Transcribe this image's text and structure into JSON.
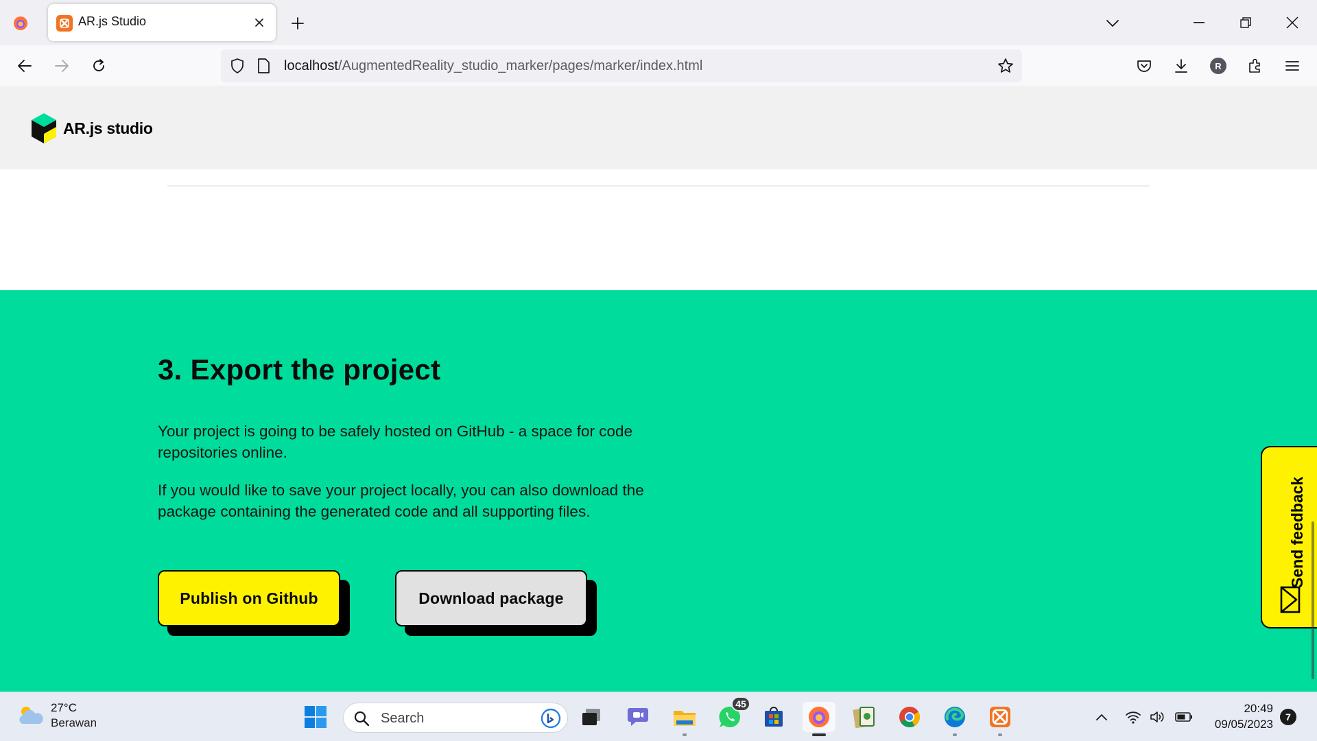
{
  "browser": {
    "tab": {
      "title": "AR.js Studio",
      "favicon": "xampp-icon"
    },
    "url": {
      "host": "localhost",
      "path": "/AugmentedReality_studio_marker/pages/marker/index.html"
    },
    "profile_initial": "R"
  },
  "site": {
    "logo_text": "AR.js studio",
    "colors": {
      "section_bg": "#00dc9b",
      "accent_yellow": "#fff200",
      "button_grey": "#e1e1e1"
    }
  },
  "export_section": {
    "title": "3. Export the project",
    "paragraph1": "Your project is going to be safely hosted on GitHub - a space for code repositories online.",
    "paragraph2": "If you would like to save your project locally, you can also download the package containing the generated code and all supporting files.",
    "publish_label": "Publish on Github",
    "download_label": "Download package"
  },
  "feedback": {
    "label": "Send feedback"
  },
  "taskbar": {
    "weather": {
      "temp": "27°C",
      "condition": "Berawan"
    },
    "search_placeholder": "Search",
    "whatsapp_badge": "45",
    "time": "20:49",
    "date": "09/05/2023",
    "notification_count": "7"
  }
}
